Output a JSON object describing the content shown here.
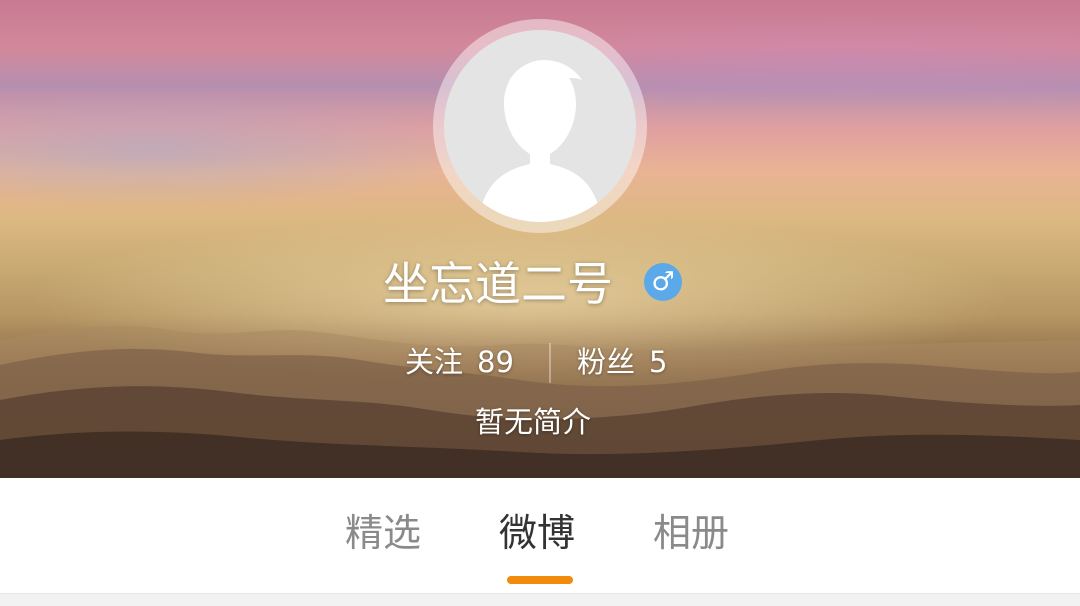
{
  "profile": {
    "username": "坐忘道二号",
    "gender_symbol": "♂",
    "follow_label": "关注",
    "follow_count": "89",
    "fans_label": "粉丝",
    "fans_count": "5",
    "bio": "暂无简介"
  },
  "tabs": [
    {
      "label": "精选",
      "active": false
    },
    {
      "label": "微博",
      "active": true
    },
    {
      "label": "相册",
      "active": false
    }
  ],
  "colors": {
    "accent_indicator": "#f28b0c",
    "gender_badge": "#5ba9e8",
    "tab_active": "#333333",
    "tab_inactive": "#8a8a8a"
  },
  "icons": {
    "avatar": "default-avatar-silhouette-icon",
    "gender": "male-gender-icon"
  }
}
